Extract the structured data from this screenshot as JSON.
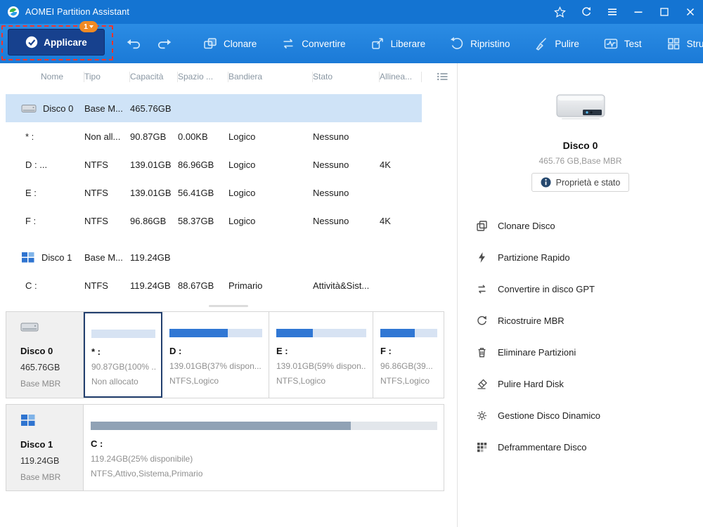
{
  "window": {
    "title": "AOMEI Partition Assistant"
  },
  "toolbar": {
    "apply_label": "Applicare",
    "apply_badge": "1",
    "items": [
      {
        "label": "Clonare"
      },
      {
        "label": "Convertire"
      },
      {
        "label": "Liberare"
      },
      {
        "label": "Ripristino"
      },
      {
        "label": "Pulire"
      },
      {
        "label": "Test"
      },
      {
        "label": "Strumenti"
      }
    ]
  },
  "table": {
    "headers": {
      "nome": "Nome",
      "tipo": "Tipo",
      "capacita": "Capacità",
      "spazio": "Spazio ...",
      "bandiera": "Bandiera",
      "stato": "Stato",
      "allinea": "Allinea..."
    },
    "rows": [
      {
        "name": "Disco 0",
        "tipo": "Base M...",
        "capacita": "465.76GB",
        "spazio": "",
        "bandiera": "",
        "stato": "",
        "allinea": ""
      },
      {
        "name": "* :",
        "tipo": "Non all...",
        "capacita": "90.87GB",
        "spazio": "0.00KB",
        "bandiera": "Logico",
        "stato": "Nessuno",
        "allinea": ""
      },
      {
        "name": "D : ...",
        "tipo": "NTFS",
        "capacita": "139.01GB",
        "spazio": "86.96GB",
        "bandiera": "Logico",
        "stato": "Nessuno",
        "allinea": "4K"
      },
      {
        "name": "E :",
        "tipo": "NTFS",
        "capacita": "139.01GB",
        "spazio": "56.41GB",
        "bandiera": "Logico",
        "stato": "Nessuno",
        "allinea": ""
      },
      {
        "name": "F :",
        "tipo": "NTFS",
        "capacita": "96.86GB",
        "spazio": "58.37GB",
        "bandiera": "Logico",
        "stato": "Nessuno",
        "allinea": "4K"
      },
      {
        "name": "Disco 1",
        "tipo": "Base M...",
        "capacita": "119.24GB",
        "spazio": "",
        "bandiera": "",
        "stato": "",
        "allinea": ""
      },
      {
        "name": "C :",
        "tipo": "NTFS",
        "capacita": "119.24GB",
        "spazio": "88.67GB",
        "bandiera": "Primario",
        "stato": "Attività&Sist...",
        "allinea": ""
      }
    ]
  },
  "diskmap": {
    "disks": [
      {
        "name": "Disco 0",
        "size": "465.76GB",
        "style": "Base MBR",
        "partitions": [
          {
            "label": "* :",
            "info": "90.87GB(100% ..",
            "fs": "Non allocato",
            "used_pct": 0
          },
          {
            "label": "D :",
            "info": "139.01GB(37% dispon...",
            "fs": "NTFS,Logico",
            "used_pct": 63
          },
          {
            "label": "E :",
            "info": "139.01GB(59% dispon...",
            "fs": "NTFS,Logico",
            "used_pct": 41
          },
          {
            "label": "F :",
            "info": "96.86GB(39...",
            "fs": "NTFS,Logico",
            "used_pct": 61
          }
        ]
      },
      {
        "name": "Disco 1",
        "size": "119.24GB",
        "style": "Base MBR",
        "partitions": [
          {
            "label": "C :",
            "info": "119.24GB(25% disponibile)",
            "fs": "NTFS,Attivo,Sistema,Primario",
            "used_pct": 75
          }
        ]
      }
    ]
  },
  "sidebar": {
    "disk_name": "Disco 0",
    "disk_info": "465.76 GB,Base MBR",
    "properties_label": "Proprietà e stato",
    "actions": [
      {
        "label": "Clonare Disco"
      },
      {
        "label": "Partizione Rapido"
      },
      {
        "label": "Convertire in disco GPT"
      },
      {
        "label": "Ricostruire MBR"
      },
      {
        "label": "Eliminare Partizioni"
      },
      {
        "label": "Pulire Hard Disk"
      },
      {
        "label": "Gestione Disco Dinamico"
      },
      {
        "label": "Deframmentare Disco"
      }
    ]
  },
  "colors": {
    "titlebar": "#1474d2",
    "toolbar": "#1b7ad7",
    "apply_button": "#17418e",
    "badge": "#f08a24",
    "selection": "#cfe3f7",
    "bar_used": "#3077d4",
    "bar_free": "#d7e3f3",
    "bar_used_gray": "#90a2b5",
    "highlight_dash": "#f5342a"
  }
}
